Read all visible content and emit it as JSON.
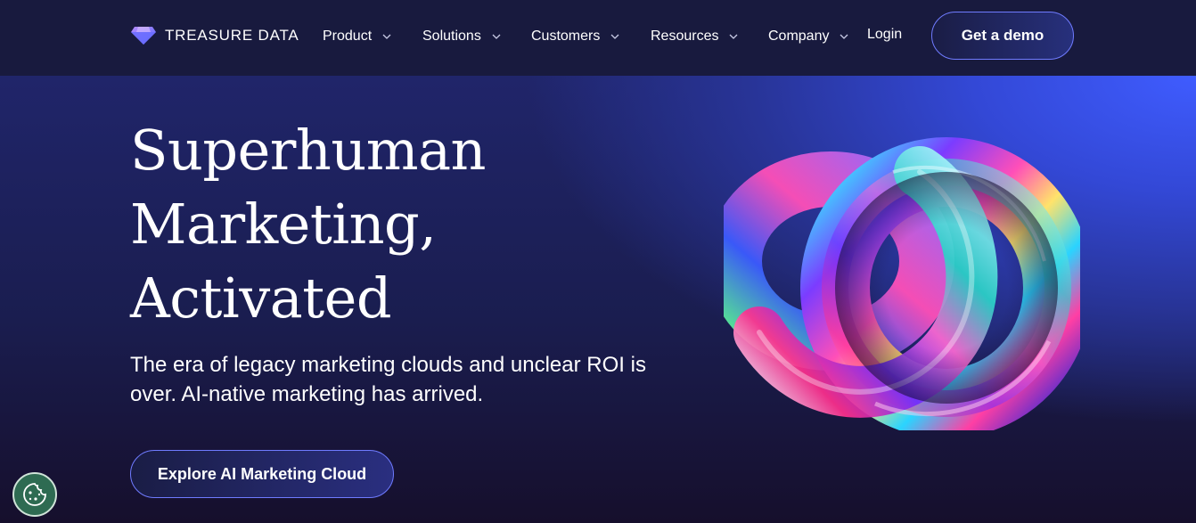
{
  "brand": {
    "name": "TREASURE DATA",
    "icon": "diamond-logo-icon"
  },
  "nav": {
    "items": [
      {
        "label": "Product",
        "icon": "chevron-down-icon"
      },
      {
        "label": "Solutions",
        "icon": "chevron-down-icon"
      },
      {
        "label": "Customers",
        "icon": "chevron-down-icon"
      },
      {
        "label": "Resources",
        "icon": "chevron-down-icon"
      },
      {
        "label": "Company",
        "icon": "chevron-down-icon"
      }
    ],
    "login": "Login",
    "demo_button": "Get a demo"
  },
  "hero": {
    "headline": [
      "Superhuman",
      "Marketing,",
      "Activated"
    ],
    "subtext": "The era of legacy marketing clouds and unclear ROI is over. AI-native marketing has arrived.",
    "cta": "Explore AI Marketing Cloud",
    "image": "iridescent-knot-illustration"
  },
  "cookie": {
    "icon": "cookie-icon"
  },
  "colors": {
    "nav_bg": "#181a3e",
    "hero_accent": "#3f5cff",
    "button_border": "#6f7bff",
    "cookie_bg": "#2e6b52"
  }
}
